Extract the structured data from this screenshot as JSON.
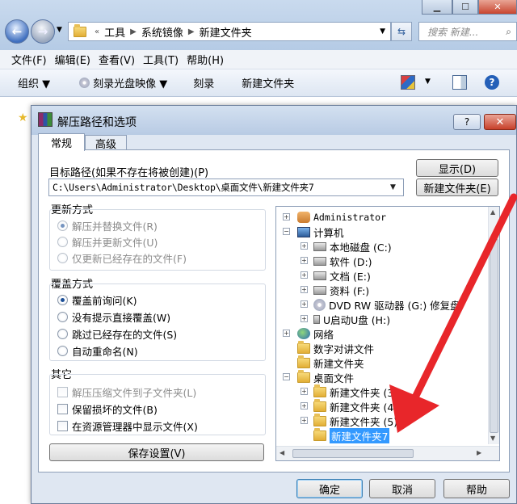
{
  "explorer": {
    "breadcrumb_prefix": "«",
    "breadcrumbs": [
      "工具",
      "系统镜像",
      "新建文件夹"
    ],
    "search_placeholder": "搜索 新建...",
    "menu": [
      "文件(F)",
      "编辑(E)",
      "查看(V)",
      "工具(T)",
      "帮助(H)"
    ],
    "toolbar": {
      "organize": "组织 ▼",
      "burn_image": "刻录光盘映像 ▼",
      "burn": "刻录",
      "new_folder": "新建文件夹"
    }
  },
  "dialog": {
    "title": "解压路径和选项",
    "help": "?",
    "close": "✕",
    "tabs": [
      "常规",
      "高级"
    ],
    "target_label": "目标路径(如果不存在将被创建)(P)",
    "target_path": "C:\\Users\\Administrator\\Desktop\\桌面文件\\新建文件夹7",
    "show_button": "显示(D)",
    "new_folder_button": "新建文件夹(E)",
    "update_mode": {
      "title": "更新方式",
      "options": [
        "解压并替换文件(R)",
        "解压并更新文件(U)",
        "仅更新已经存在的文件(F)"
      ]
    },
    "overwrite_mode": {
      "title": "覆盖方式",
      "options": [
        "覆盖前询问(K)",
        "没有提示直接覆盖(W)",
        "跳过已经存在的文件(S)",
        "自动重命名(N)"
      ]
    },
    "misc": {
      "title": "其它",
      "options": [
        "解压压缩文件到子文件夹(L)",
        "保留损坏的文件(B)",
        "在资源管理器中显示文件(X)"
      ]
    },
    "save_settings": "保存设置(V)",
    "tree": [
      {
        "label": "Administrator",
        "icon": "user-folder-icon"
      },
      {
        "label": "计算机",
        "icon": "computer-icon"
      },
      {
        "label": "本地磁盘 (C:)",
        "icon": "drive-icon"
      },
      {
        "label": "软件 (D:)",
        "icon": "drive-icon"
      },
      {
        "label": "文档 (E:)",
        "icon": "drive-icon"
      },
      {
        "label": "资料 (F:)",
        "icon": "drive-icon"
      },
      {
        "label": "DVD RW 驱动器 (G:) 修复盘",
        "icon": "dvd-icon"
      },
      {
        "label": "U启动U盘 (H:)",
        "icon": "usb-drive-icon"
      },
      {
        "label": "网络",
        "icon": "network-icon"
      },
      {
        "label": "数字对讲文件",
        "icon": "folder-icon"
      },
      {
        "label": "新建文件夹",
        "icon": "folder-icon"
      },
      {
        "label": "桌面文件",
        "icon": "folder-icon"
      },
      {
        "label": "新建文件夹 (3)",
        "icon": "folder-icon"
      },
      {
        "label": "新建文件夹 (4)",
        "icon": "folder-icon"
      },
      {
        "label": "新建文件夹 (5)",
        "icon": "folder-icon"
      },
      {
        "label": "新建文件夹7",
        "icon": "folder-icon",
        "selected": true
      }
    ],
    "ok": "确定",
    "cancel": "取消",
    "help_button": "帮助"
  },
  "colors": {
    "selection": "#3399ff",
    "annotation_arrow": "#e8262a"
  }
}
